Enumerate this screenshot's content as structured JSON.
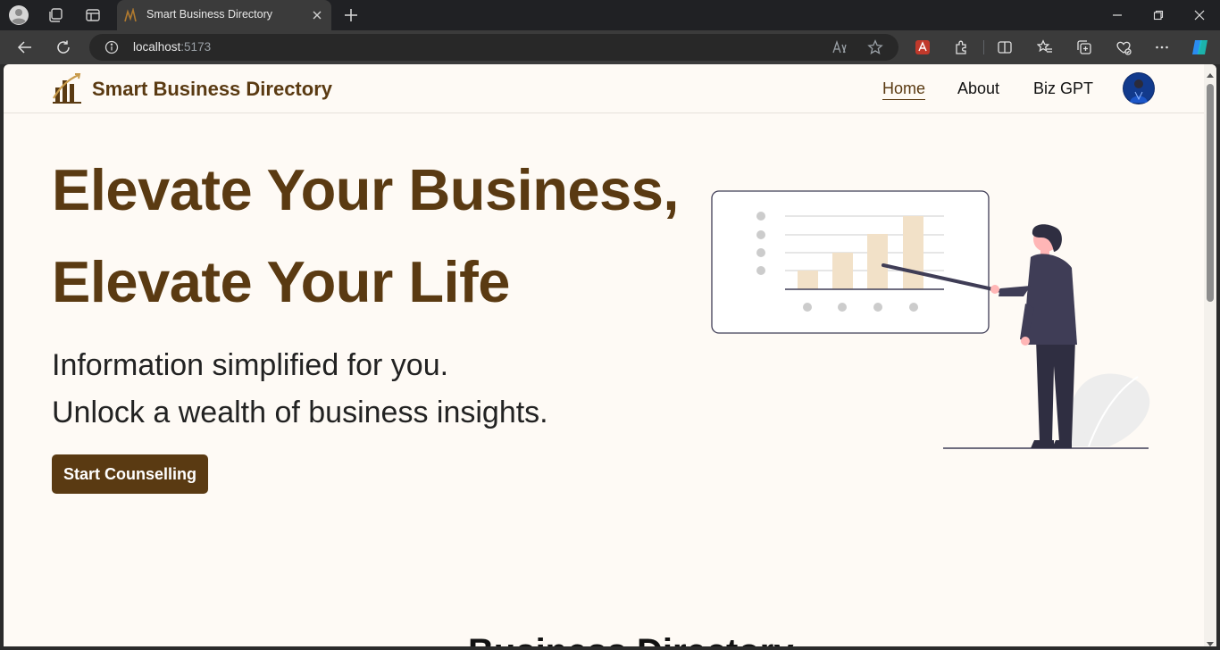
{
  "browser": {
    "tab_title": "Smart Business Directory",
    "url_host": "localhost",
    "url_port": ":5173"
  },
  "nav": {
    "brand": "Smart Business Directory",
    "links": [
      "Home",
      "About",
      "Biz GPT"
    ],
    "active_link": "Home"
  },
  "hero": {
    "heading_line1": "Elevate Your Business,",
    "heading_line2": "Elevate Your Life",
    "subtitle_line1": "Information simplified for you.",
    "subtitle_line2": "Unlock a wealth of business insights.",
    "cta_label": "Start Counselling"
  },
  "peek": {
    "text": "Business Directory"
  },
  "colors": {
    "brand": "#5a3a12",
    "page_bg": "#fefaf5",
    "bar_fill": "#f2e1c8"
  }
}
